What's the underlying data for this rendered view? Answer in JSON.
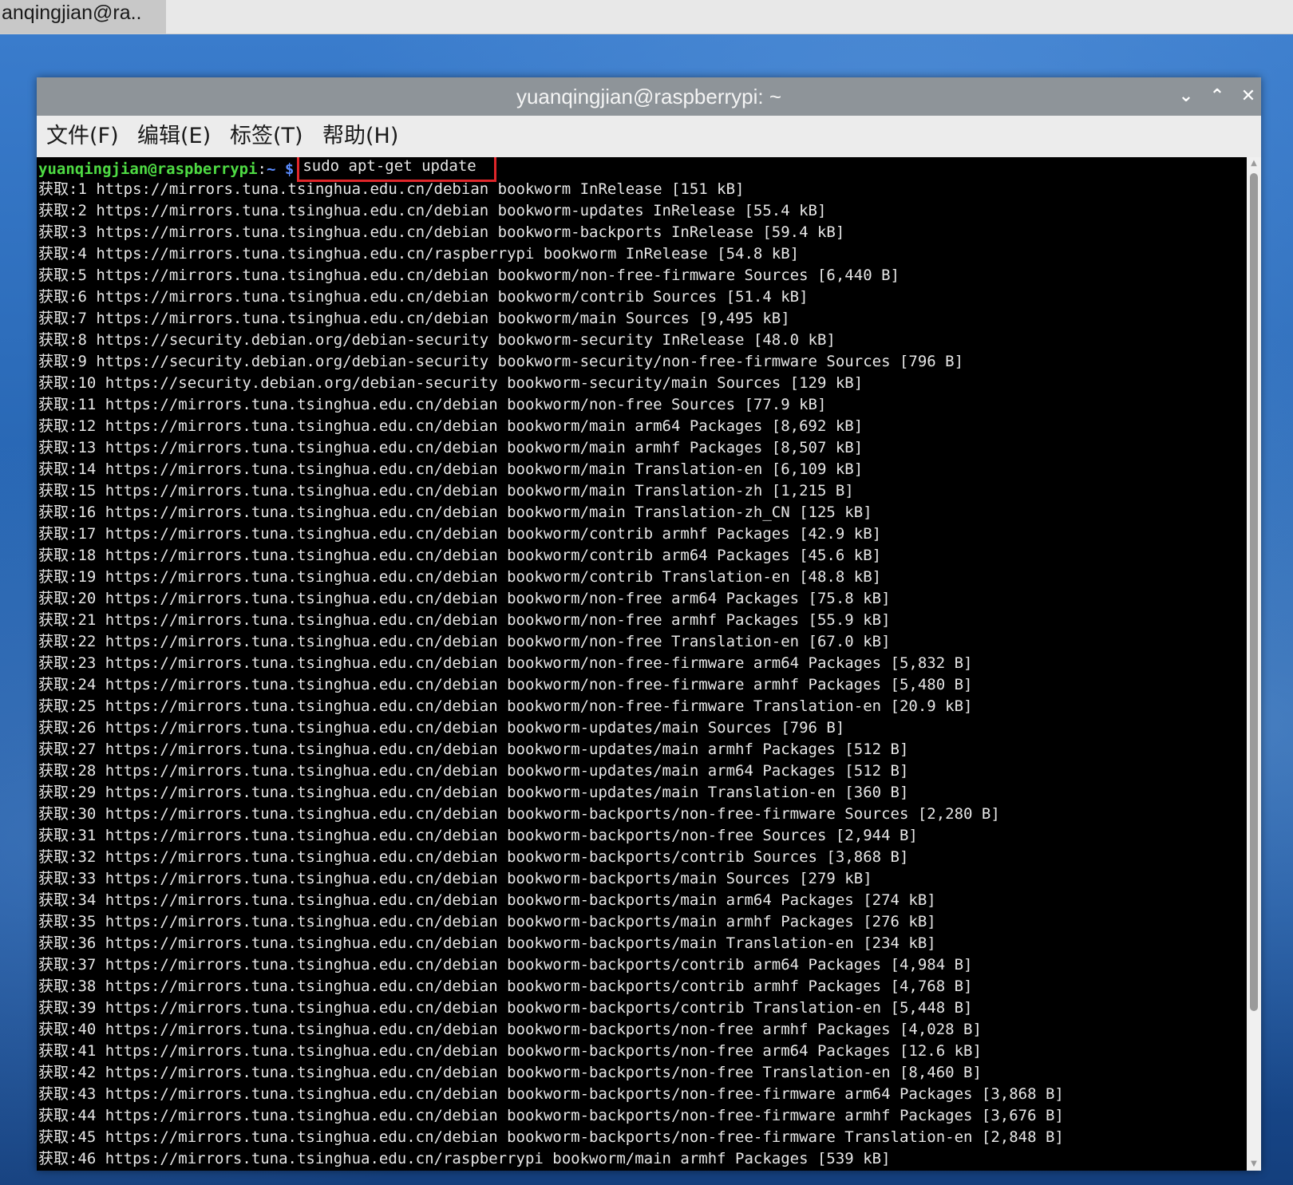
{
  "taskbar": {
    "item_label": "anqingjian@ra.."
  },
  "window": {
    "title": "yuanqingjian@raspberrypi: ~",
    "minimize_glyph": "⌄",
    "maximize_glyph": "⌃",
    "close_glyph": "✕"
  },
  "menu": {
    "file": "文件(F)",
    "edit": "编辑(E)",
    "tabs": "标签(T)",
    "help": "帮助(H)"
  },
  "terminal": {
    "prompt_user": "yuanqingjian@raspberrypi",
    "prompt_sep": ":",
    "prompt_path": "~",
    "prompt_dollar": "$",
    "command": "sudo apt-get update",
    "lines": [
      "获取:1 https://mirrors.tuna.tsinghua.edu.cn/debian bookworm InRelease [151 kB]",
      "获取:2 https://mirrors.tuna.tsinghua.edu.cn/debian bookworm-updates InRelease [55.4 kB]",
      "获取:3 https://mirrors.tuna.tsinghua.edu.cn/debian bookworm-backports InRelease [59.4 kB]",
      "获取:4 https://mirrors.tuna.tsinghua.edu.cn/raspberrypi bookworm InRelease [54.8 kB]",
      "获取:5 https://mirrors.tuna.tsinghua.edu.cn/debian bookworm/non-free-firmware Sources [6,440 B]",
      "获取:6 https://mirrors.tuna.tsinghua.edu.cn/debian bookworm/contrib Sources [51.4 kB]",
      "获取:7 https://mirrors.tuna.tsinghua.edu.cn/debian bookworm/main Sources [9,495 kB]",
      "获取:8 https://security.debian.org/debian-security bookworm-security InRelease [48.0 kB]",
      "获取:9 https://security.debian.org/debian-security bookworm-security/non-free-firmware Sources [796 B]",
      "获取:10 https://security.debian.org/debian-security bookworm-security/main Sources [129 kB]",
      "获取:11 https://mirrors.tuna.tsinghua.edu.cn/debian bookworm/non-free Sources [77.9 kB]",
      "获取:12 https://mirrors.tuna.tsinghua.edu.cn/debian bookworm/main arm64 Packages [8,692 kB]",
      "获取:13 https://mirrors.tuna.tsinghua.edu.cn/debian bookworm/main armhf Packages [8,507 kB]",
      "获取:14 https://mirrors.tuna.tsinghua.edu.cn/debian bookworm/main Translation-en [6,109 kB]",
      "获取:15 https://mirrors.tuna.tsinghua.edu.cn/debian bookworm/main Translation-zh [1,215 B]",
      "获取:16 https://mirrors.tuna.tsinghua.edu.cn/debian bookworm/main Translation-zh_CN [125 kB]",
      "获取:17 https://mirrors.tuna.tsinghua.edu.cn/debian bookworm/contrib armhf Packages [42.9 kB]",
      "获取:18 https://mirrors.tuna.tsinghua.edu.cn/debian bookworm/contrib arm64 Packages [45.6 kB]",
      "获取:19 https://mirrors.tuna.tsinghua.edu.cn/debian bookworm/contrib Translation-en [48.8 kB]",
      "获取:20 https://mirrors.tuna.tsinghua.edu.cn/debian bookworm/non-free arm64 Packages [75.8 kB]",
      "获取:21 https://mirrors.tuna.tsinghua.edu.cn/debian bookworm/non-free armhf Packages [55.9 kB]",
      "获取:22 https://mirrors.tuna.tsinghua.edu.cn/debian bookworm/non-free Translation-en [67.0 kB]",
      "获取:23 https://mirrors.tuna.tsinghua.edu.cn/debian bookworm/non-free-firmware arm64 Packages [5,832 B]",
      "获取:24 https://mirrors.tuna.tsinghua.edu.cn/debian bookworm/non-free-firmware armhf Packages [5,480 B]",
      "获取:25 https://mirrors.tuna.tsinghua.edu.cn/debian bookworm/non-free-firmware Translation-en [20.9 kB]",
      "获取:26 https://mirrors.tuna.tsinghua.edu.cn/debian bookworm-updates/main Sources [796 B]",
      "获取:27 https://mirrors.tuna.tsinghua.edu.cn/debian bookworm-updates/main armhf Packages [512 B]",
      "获取:28 https://mirrors.tuna.tsinghua.edu.cn/debian bookworm-updates/main arm64 Packages [512 B]",
      "获取:29 https://mirrors.tuna.tsinghua.edu.cn/debian bookworm-updates/main Translation-en [360 B]",
      "获取:30 https://mirrors.tuna.tsinghua.edu.cn/debian bookworm-backports/non-free-firmware Sources [2,280 B]",
      "获取:31 https://mirrors.tuna.tsinghua.edu.cn/debian bookworm-backports/non-free Sources [2,944 B]",
      "获取:32 https://mirrors.tuna.tsinghua.edu.cn/debian bookworm-backports/contrib Sources [3,868 B]",
      "获取:33 https://mirrors.tuna.tsinghua.edu.cn/debian bookworm-backports/main Sources [279 kB]",
      "获取:34 https://mirrors.tuna.tsinghua.edu.cn/debian bookworm-backports/main arm64 Packages [274 kB]",
      "获取:35 https://mirrors.tuna.tsinghua.edu.cn/debian bookworm-backports/main armhf Packages [276 kB]",
      "获取:36 https://mirrors.tuna.tsinghua.edu.cn/debian bookworm-backports/main Translation-en [234 kB]",
      "获取:37 https://mirrors.tuna.tsinghua.edu.cn/debian bookworm-backports/contrib arm64 Packages [4,984 B]",
      "获取:38 https://mirrors.tuna.tsinghua.edu.cn/debian bookworm-backports/contrib armhf Packages [4,768 B]",
      "获取:39 https://mirrors.tuna.tsinghua.edu.cn/debian bookworm-backports/contrib Translation-en [5,448 B]",
      "获取:40 https://mirrors.tuna.tsinghua.edu.cn/debian bookworm-backports/non-free armhf Packages [4,028 B]",
      "获取:41 https://mirrors.tuna.tsinghua.edu.cn/debian bookworm-backports/non-free arm64 Packages [12.6 kB]",
      "获取:42 https://mirrors.tuna.tsinghua.edu.cn/debian bookworm-backports/non-free Translation-en [8,460 B]",
      "获取:43 https://mirrors.tuna.tsinghua.edu.cn/debian bookworm-backports/non-free-firmware arm64 Packages [3,868 B]",
      "获取:44 https://mirrors.tuna.tsinghua.edu.cn/debian bookworm-backports/non-free-firmware armhf Packages [3,676 B]",
      "获取:45 https://mirrors.tuna.tsinghua.edu.cn/debian bookworm-backports/non-free-firmware Translation-en [2,848 B]",
      "获取:46 https://mirrors.tuna.tsinghua.edu.cn/raspberrypi bookworm/main armhf Packages [539 kB]"
    ]
  },
  "colors": {
    "prompt_user": "#4edb43",
    "prompt_path": "#5a8cff",
    "highlight_box": "#e0262a",
    "terminal_bg": "#000000",
    "titlebar_bg": "#8e9499"
  }
}
